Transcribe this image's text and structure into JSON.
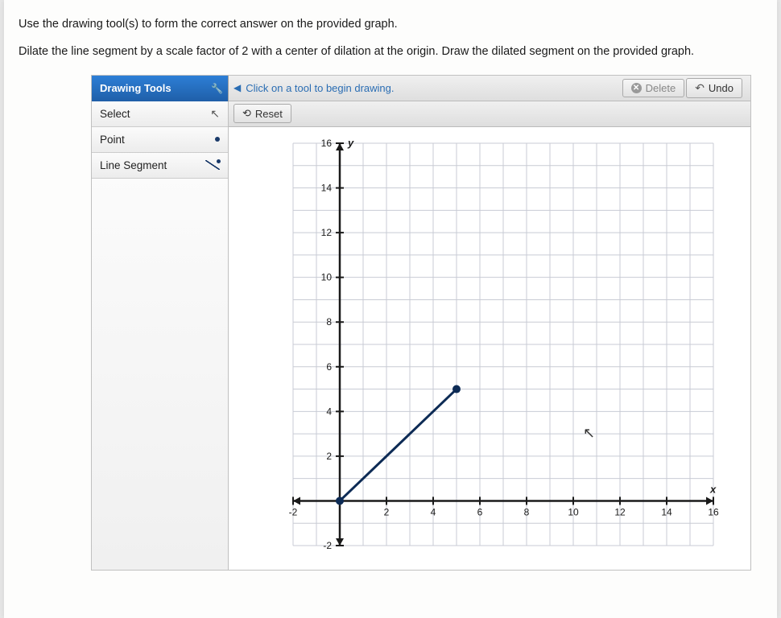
{
  "instruction": "Use the drawing tool(s) to form the correct answer on the provided graph.",
  "problem": "Dilate the line segment by a scale factor of 2 with a center of dilation at the origin. Draw the dilated segment on the provided graph.",
  "toolbar": {
    "header": "Drawing Tools",
    "hint": "Click on a tool to begin drawing.",
    "delete": "Delete",
    "undo": "Undo",
    "reset": "Reset"
  },
  "tools": {
    "select": "Select",
    "point": "Point",
    "line_segment": "Line Segment"
  },
  "chart_data": {
    "type": "line",
    "title": "",
    "xlabel": "x",
    "ylabel": "y",
    "xlim": [
      -2,
      16
    ],
    "ylim": [
      -2,
      16
    ],
    "x_ticks": [
      -2,
      2,
      4,
      6,
      8,
      10,
      12,
      14,
      16
    ],
    "y_ticks": [
      -2,
      2,
      4,
      6,
      8,
      10,
      12,
      14,
      16
    ],
    "segment": {
      "x1": 0,
      "y1": 0,
      "x2": 5,
      "y2": 5
    },
    "grid": true
  }
}
